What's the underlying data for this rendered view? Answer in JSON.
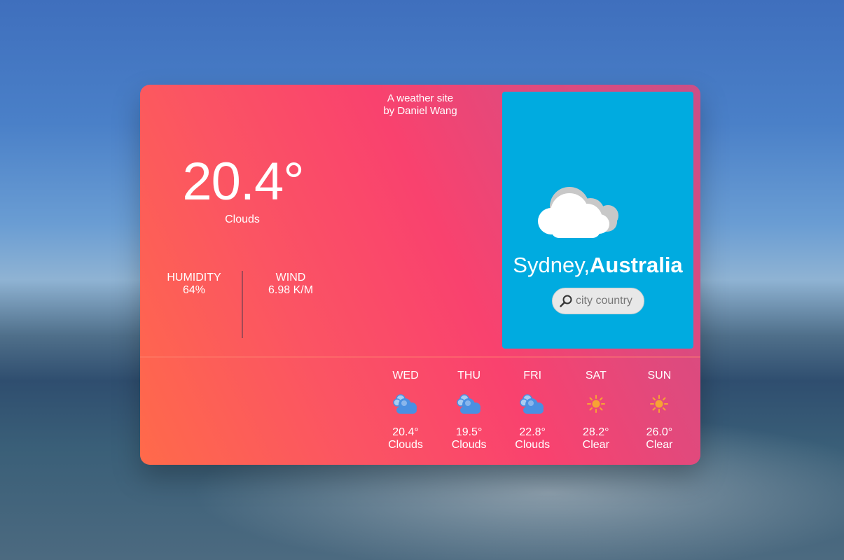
{
  "site": {
    "credit_line1": "A weather site",
    "credit_line2": "by Daniel Wang"
  },
  "current": {
    "temperature": "20.4°",
    "condition": "Clouds",
    "humidity_label": "HUMIDITY",
    "humidity_value": "64%",
    "wind_label": "WIND",
    "wind_value": "6.98 K/M",
    "icon": "cloud-icon"
  },
  "location": {
    "city": "Sydney,",
    "country": "Australia"
  },
  "search": {
    "placeholder": "city country",
    "icon": "search-icon"
  },
  "forecast": [
    {
      "day": "WED",
      "temp": "20.4°",
      "condition": "Clouds",
      "icon": "cloud-sun-icon"
    },
    {
      "day": "THU",
      "temp": "19.5°",
      "condition": "Clouds",
      "icon": "cloud-sun-icon"
    },
    {
      "day": "FRI",
      "temp": "22.8°",
      "condition": "Clouds",
      "icon": "cloud-sun-icon"
    },
    {
      "day": "SAT",
      "temp": "28.2°",
      "condition": "Clear",
      "icon": "sun-icon"
    },
    {
      "day": "SUN",
      "temp": "26.0°",
      "condition": "Clear",
      "icon": "sun-icon"
    }
  ],
  "colors": {
    "panel": "#00abe0",
    "card_gradient_start": "#ff6a4a",
    "card_gradient_end": "#cb4f86",
    "cloud_icon": "#4a90e2",
    "sun_icon": "#f7a234"
  }
}
